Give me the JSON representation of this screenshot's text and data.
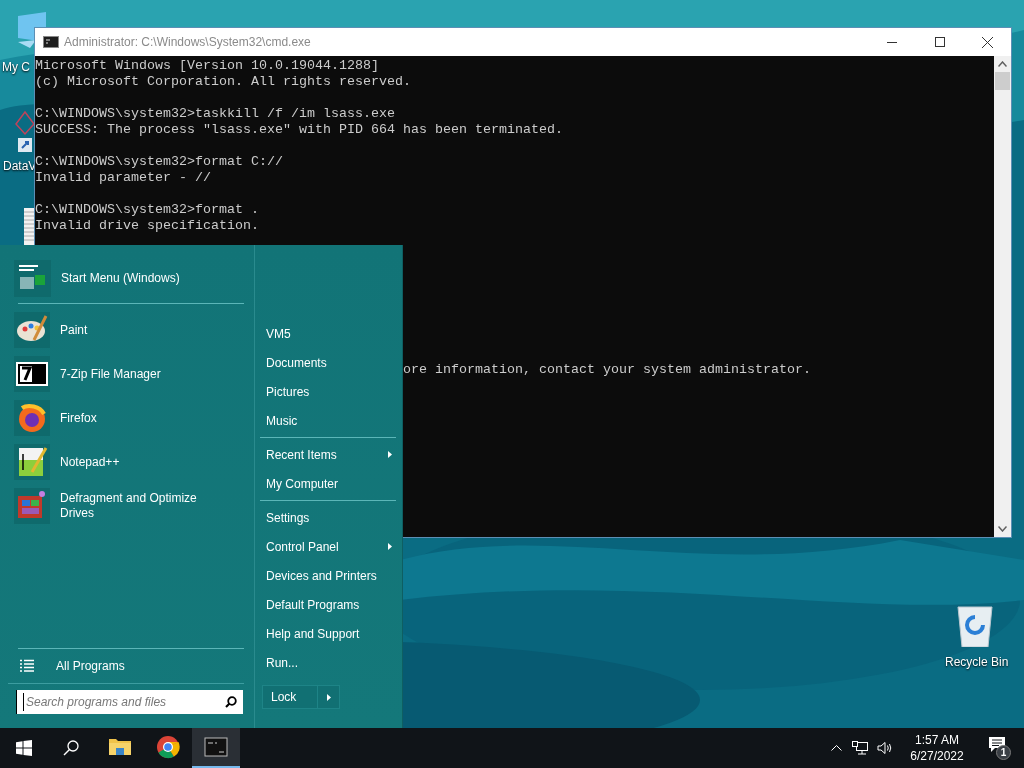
{
  "desktop_icons": [
    {
      "label": "My C"
    },
    {
      "label": "DataV"
    }
  ],
  "console_window": {
    "title": "Administrator: C:\\Windows\\System32\\cmd.exe",
    "blocks": [
      [
        "Microsoft Windows [Version 10.0.19044.1288]",
        "(c) Microsoft Corporation. All rights reserved."
      ],
      [
        "C:\\WINDOWS\\system32>taskkill /f /im lsass.exe",
        "SUCCESS: The process \"lsass.exe\" with PID 664 has been terminated."
      ],
      [
        "C:\\WINDOWS\\system32>format C://",
        "Invalid parameter - //"
      ],
      [
        "C:\\WINDOWS\\system32>format .",
        "Invalid drive specification."
      ]
    ],
    "partial_line": "ore information, contact your system administrator."
  },
  "start_menu": {
    "pinned": {
      "label": "Start Menu (Windows)"
    },
    "programs": [
      {
        "label": "Paint"
      },
      {
        "label": "7-Zip File Manager"
      },
      {
        "label": "Firefox"
      },
      {
        "label": "Notepad++"
      },
      {
        "label": "Defragment and Optimize Drives"
      }
    ],
    "all_programs": "All Programs",
    "search": {
      "placeholder": "Search programs and files"
    },
    "right_groups": [
      [
        {
          "label": "VM5",
          "submenu": false
        },
        {
          "label": "Documents",
          "submenu": false
        },
        {
          "label": "Pictures",
          "submenu": false
        },
        {
          "label": "Music",
          "submenu": false
        }
      ],
      [
        {
          "label": "Recent Items",
          "submenu": true
        },
        {
          "label": "My Computer",
          "submenu": false
        }
      ],
      [
        {
          "label": "Settings",
          "submenu": false
        },
        {
          "label": "Control Panel",
          "submenu": true
        },
        {
          "label": "Devices and Printers",
          "submenu": false
        },
        {
          "label": "Default Programs",
          "submenu": false
        },
        {
          "label": "Help and Support",
          "submenu": false
        },
        {
          "label": "Run...",
          "submenu": false
        }
      ]
    ],
    "power_button": "Lock"
  },
  "recycle_bin": {
    "label": "Recycle Bin"
  },
  "taskbar": {
    "apps": [
      {
        "selected": false
      },
      {
        "selected": false
      },
      {
        "selected": true
      }
    ],
    "time": "1:57 AM",
    "date": "6/27/2022",
    "notification_count": "1"
  }
}
